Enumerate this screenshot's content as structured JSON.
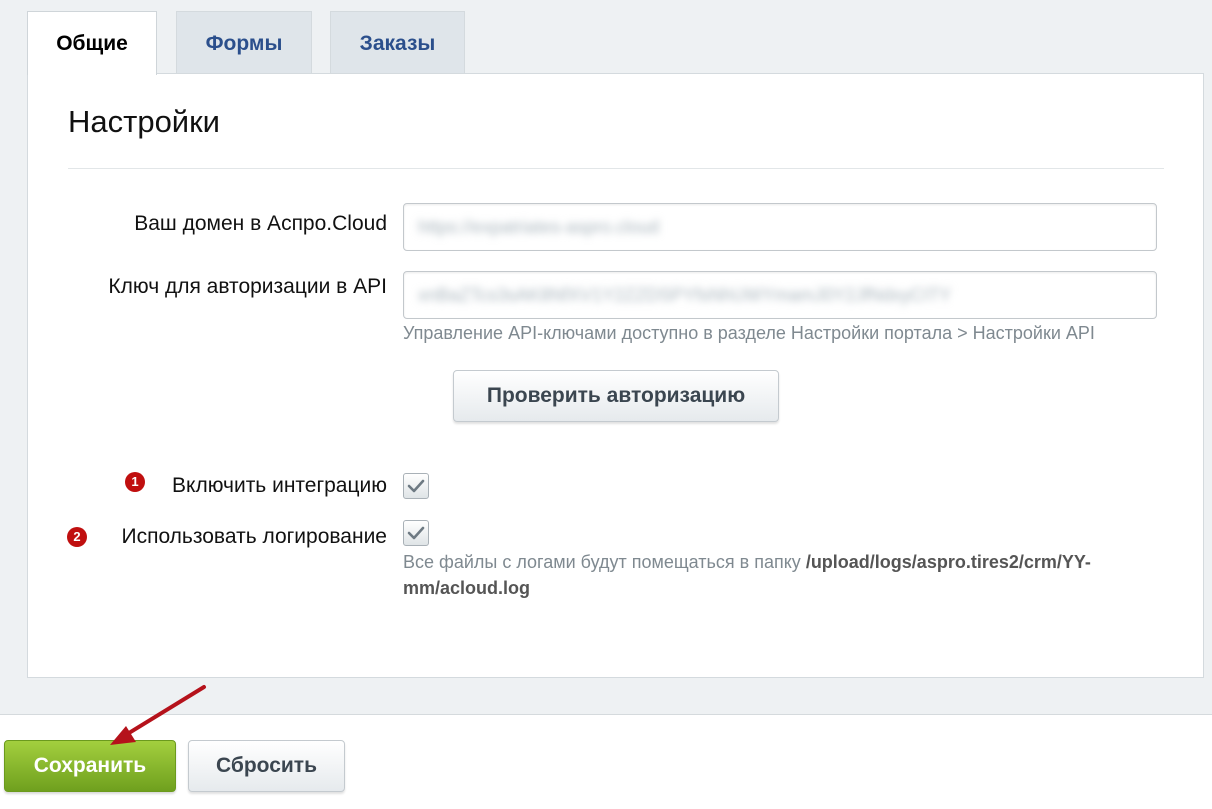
{
  "tabs": [
    {
      "label": "Общие",
      "active": true
    },
    {
      "label": "Формы",
      "active": false
    },
    {
      "label": "Заказы",
      "active": false
    }
  ],
  "settings": {
    "title": "Настройки",
    "domain": {
      "label": "Ваш домен в Аспро.Cloud",
      "value": "https://expatriates-aspro.cloud"
    },
    "api_key": {
      "label": "Ключ для авторизации в API",
      "value": "xnBaZTcs3sAK8NfXV1Y2ZZDSPYfsNhUWYmamJ0Y2JfNdxyCITY",
      "hint": "Управление API-ключами доступно в разделе Настройки портала > Настройки API"
    },
    "check_auth_button": "Проверить авторизацию",
    "enable_integration": {
      "badge": "1",
      "label": "Включить интеграцию",
      "checked": true
    },
    "use_logging": {
      "badge": "2",
      "label": "Использовать логирование",
      "checked": true,
      "hint_prefix": "Все файлы с логами будут помещаться в папку ",
      "hint_path_line1": "/upload/logs/aspro.tires2/crm/YY-",
      "hint_path_line2": "mm/acloud.log"
    }
  },
  "footer": {
    "save_button": "Сохранить",
    "reset_button": "Сбросить"
  },
  "colors": {
    "save_button": "#8cbd2f",
    "badge": "#c00f0f",
    "tab_text": "#2b4f8c",
    "annotation_arrow": "#b5121b"
  },
  "icons": {
    "checkbox_mark": "check-icon",
    "annotation": "red-arrow-icon"
  }
}
